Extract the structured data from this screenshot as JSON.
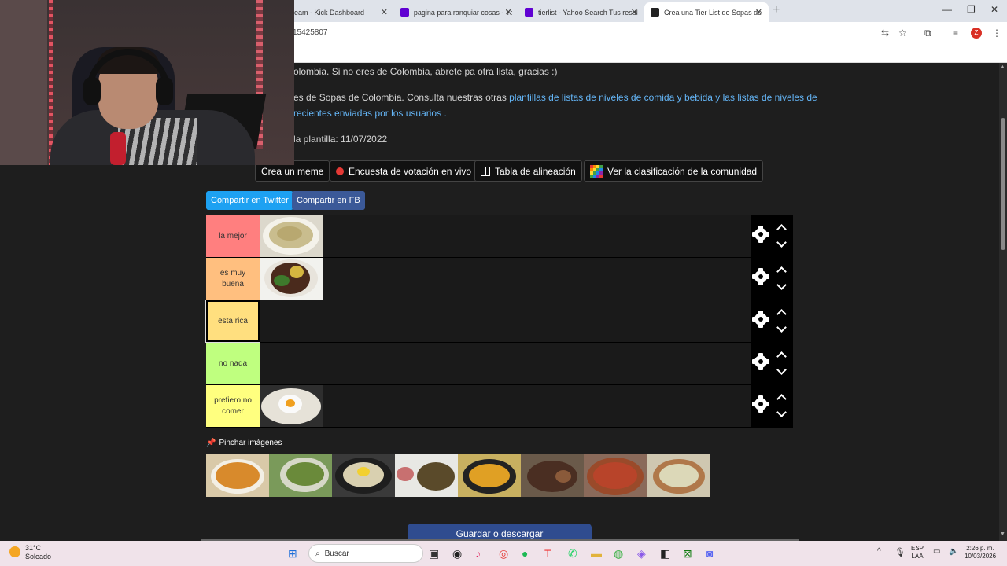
{
  "browser": {
    "tabs": [
      {
        "title": "eam - Kick Dashboard",
        "favicon_color": "#53fc18",
        "active": false
      },
      {
        "title": "pagina para ranquiar cosas - Ya",
        "favicon_color": "#6001d2",
        "active": false
      },
      {
        "title": "tierlist - Yahoo Search Tus resul",
        "favicon_color": "#6001d2",
        "active": false
      },
      {
        "title": "Crea una Tier List de Sopas de",
        "favicon_color": "#222222",
        "active": true
      }
    ],
    "url": "15425807",
    "profile_initial": "Z"
  },
  "page": {
    "intro_line1": "olombia. Si no eres de Colombia, abrete pa otra lista, gracias :)",
    "intro_line2_prefix": "es de Sopas de Colombia. Consulta nuestras otras ",
    "intro_line2_link": "plantillas de listas de niveles de comida y bebida y las listas de niveles de",
    "intro_line3": "recientes enviadas por los usuarios .",
    "template_date": "la plantilla: 11/07/2022",
    "buttons": {
      "meme": "Crea un meme",
      "poll": "Encuesta de votación en vivo",
      "alignment": "Tabla de alineación",
      "community": "Ver la clasificación de la comunidad"
    },
    "share": {
      "twitter": "Compartir en Twitter",
      "facebook": "Compartir en FB"
    },
    "tiers": [
      {
        "label": "la mejor",
        "color": "#ff7f7f"
      },
      {
        "label": "es muy buena",
        "color": "#ffbf7f"
      },
      {
        "label": "esta rica",
        "color": "#ffdf7f"
      },
      {
        "label": "no nada",
        "color": "#bfff7f"
      },
      {
        "label": "prefiero no comer",
        "color": "#ffff7f"
      }
    ],
    "pin_label": "Pinchar imágenes",
    "save_button": "Guardar o descargar"
  },
  "taskbar": {
    "temperature": "31°C",
    "weather": "Soleado",
    "search_placeholder": "Buscar",
    "lang_top": "ESP",
    "lang_bottom": "LAA",
    "time": "2:26 p. m.",
    "date": "10/03/2026"
  }
}
